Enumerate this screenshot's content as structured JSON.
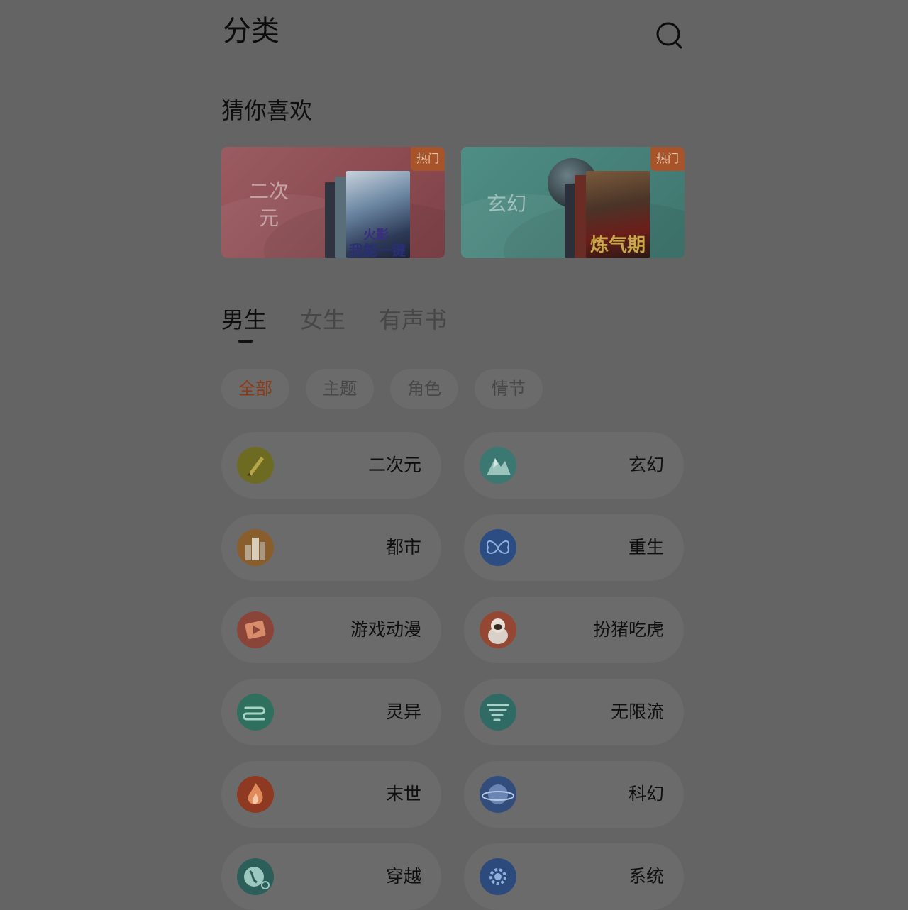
{
  "header": {
    "title": "分类"
  },
  "recommend": {
    "title": "猜你喜欢",
    "cards": [
      {
        "label": "二次元",
        "badge": "热门",
        "book_title_top": "火影",
        "book_title": "我能一键满级"
      },
      {
        "label": "玄幻",
        "badge": "热门",
        "book_title": "炼气期"
      }
    ]
  },
  "tabs": [
    {
      "label": "男生"
    },
    {
      "label": "女生"
    },
    {
      "label": "有声书"
    }
  ],
  "chips": [
    {
      "label": "全部"
    },
    {
      "label": "主题"
    },
    {
      "label": "角色"
    },
    {
      "label": "情节"
    }
  ],
  "categories": [
    {
      "label": "二次元",
      "icon": "brush-icon",
      "color": "#6d6a22"
    },
    {
      "label": "玄幻",
      "icon": "mountain-icon",
      "color": "#3b7872"
    },
    {
      "label": "都市",
      "icon": "city-icon",
      "color": "#8a5e2c"
    },
    {
      "label": "重生",
      "icon": "butterfly-icon",
      "color": "#2b4d84"
    },
    {
      "label": "游戏动漫",
      "icon": "play-icon",
      "color": "#8a4438"
    },
    {
      "label": "扮猪吃虎",
      "icon": "pig-icon",
      "color": "#944834"
    },
    {
      "label": "灵异",
      "icon": "wind-icon",
      "color": "#2f6f5e"
    },
    {
      "label": "无限流",
      "icon": "tornado-icon",
      "color": "#2f6b64"
    },
    {
      "label": "末世",
      "icon": "fire-icon",
      "color": "#8e3a22"
    },
    {
      "label": "科幻",
      "icon": "planet-icon",
      "color": "#324d7c"
    },
    {
      "label": "穿越",
      "icon": "globe-icon",
      "color": "#2c5f5a"
    },
    {
      "label": "系统",
      "icon": "gear-icon",
      "color": "#2d4a7c"
    }
  ]
}
